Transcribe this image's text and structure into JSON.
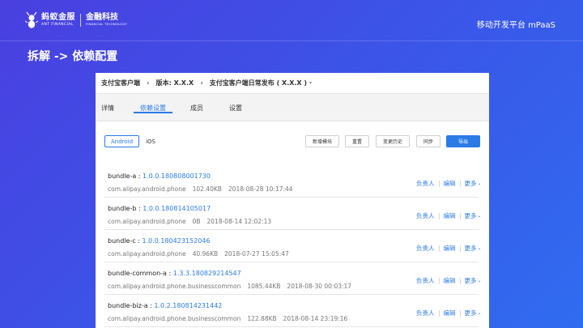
{
  "brand": {
    "logo_cn": "蚂蚁金服",
    "logo_en": "ANT FINANCIAL",
    "second_cn": "金融科技",
    "second_en": "FINANCIAL TECHNOLOGY"
  },
  "header": {
    "platform": "移动开发平台 mPaaS",
    "slide_title": "拆解 -> 依赖配置"
  },
  "breadcrumb": {
    "items": [
      "支付宝客户端",
      "版本: X.X.X",
      "支付宝客户端日常发布 ( X.X.X )"
    ],
    "separator": "›",
    "caret": "▾"
  },
  "tabs": [
    {
      "label": "详情"
    },
    {
      "label": "依赖设置"
    },
    {
      "label": "成员"
    },
    {
      "label": "设置"
    }
  ],
  "platform_switch": {
    "android": "Android",
    "ios": "iOS"
  },
  "toolbar": {
    "add_module": "新增模块",
    "reset": "重置",
    "history": "变更历史",
    "sync": "同步",
    "export": "导出"
  },
  "row_actions": {
    "owner": "负责人",
    "edit": "编辑",
    "more": "更多",
    "more_chevron": "⌄"
  },
  "bundles": [
    {
      "name": "bundle-a",
      "version": "1.0.0.180808001730",
      "package": "com.alipay.android.phone",
      "size": "102.40KB",
      "time": "2018-08-28 10:17:44"
    },
    {
      "name": "bundle-b",
      "version": "1.0.0.180814105017",
      "package": "com.alipay.android.phone",
      "size": "0B",
      "time": "2018-08-14 12:02:13"
    },
    {
      "name": "bundle-c",
      "version": "1.0.0.180423152046",
      "package": "com.alipay.android.phone",
      "size": "40.96KB",
      "time": "2018-07-27 15:05:47"
    },
    {
      "name": "bundle-common-a",
      "version": "1.3.3.180829214547",
      "package": "com.alipay.android.phone.businesscommon",
      "size": "1085.44KB",
      "time": "2018-08-30 00:03:17"
    },
    {
      "name": "bundle-biz-a",
      "version": "1.0.2.180814231442",
      "package": "com.alipay.android.phone.businesscommon",
      "size": "122.88KB",
      "time": "2018-08-14 23:19:16"
    }
  ]
}
